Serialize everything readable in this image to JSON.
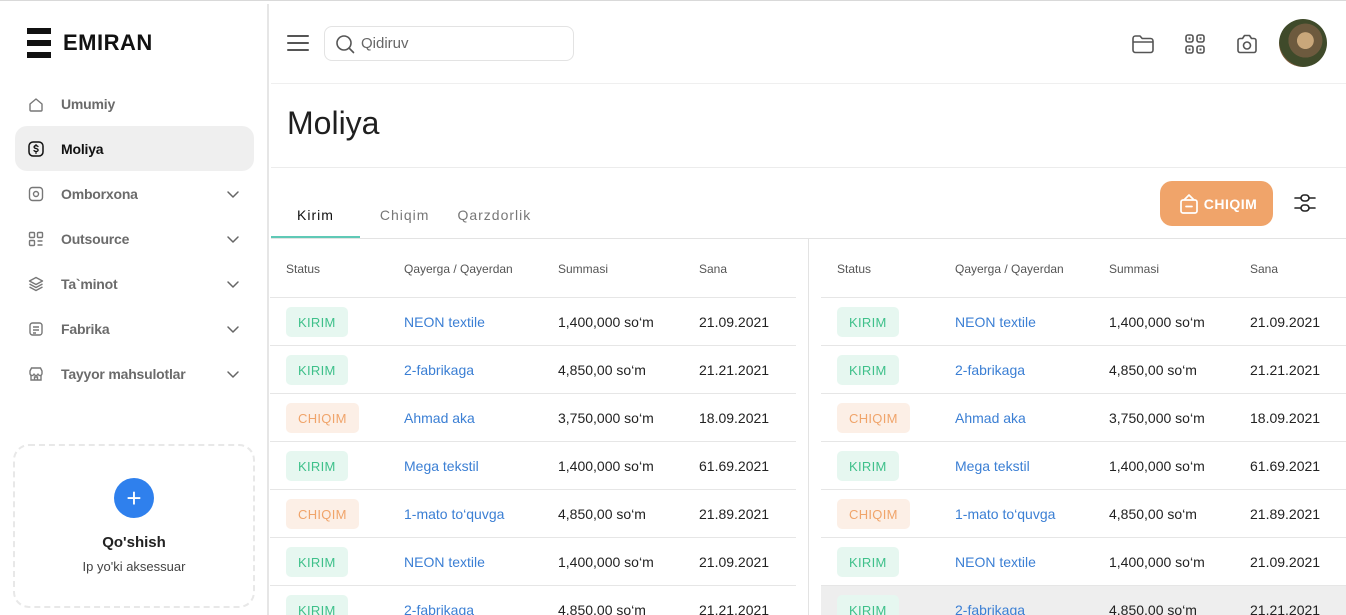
{
  "brand": {
    "name": "EMIRAN"
  },
  "sidebar": {
    "items": [
      {
        "label": "Umumiy",
        "icon": "home-icon",
        "active": false,
        "expandable": false
      },
      {
        "label": "Moliya",
        "icon": "dollar-icon",
        "active": true,
        "expandable": false
      },
      {
        "label": "Omborxona",
        "icon": "box-icon",
        "active": false,
        "expandable": true
      },
      {
        "label": "Outsource",
        "icon": "grid-icon",
        "active": false,
        "expandable": true
      },
      {
        "label": "Ta`minot",
        "icon": "layers-icon",
        "active": false,
        "expandable": true
      },
      {
        "label": "Fabrika",
        "icon": "factory-icon",
        "active": false,
        "expandable": true
      },
      {
        "label": "Tayyor mahsulotlar",
        "icon": "store-icon",
        "active": false,
        "expandable": true
      }
    ],
    "add_card": {
      "title": "Qo'shish",
      "subtitle": "Ip yo'ki aksessuar"
    }
  },
  "header": {
    "search_placeholder": "Qidiruv",
    "icons": [
      "folder-icon",
      "qr-scan-icon",
      "camera-icon"
    ]
  },
  "page": {
    "title": "Moliya"
  },
  "tabs": [
    {
      "label": "Kirim",
      "active": true
    },
    {
      "label": "Chiqim",
      "active": false
    },
    {
      "label": "Qarzdorlik",
      "active": false
    }
  ],
  "action_button": {
    "label": "CHIQIM"
  },
  "colors": {
    "accent_orange": "#f0a46a",
    "accent_teal": "#5fc9b6",
    "link_blue": "#3b7fd4",
    "kirim_green": "#3ec08a",
    "primary_blue": "#2f80ed"
  },
  "table": {
    "columns": [
      "Status",
      "Qayerga / Qayerdan",
      "Summasi",
      "Sana"
    ],
    "rows": [
      {
        "status": "KIRIM",
        "type": "kirim",
        "party": "NEON textile",
        "amount": "1,400,000 so‘m",
        "date": "21.09.2021"
      },
      {
        "status": "KIRIM",
        "type": "kirim",
        "party": "2-fabrikaga",
        "amount": "4,850,00 so‘m",
        "date": "21.21.2021"
      },
      {
        "status": "CHIQIM",
        "type": "chiqim",
        "party": "Ahmad aka",
        "amount": "3,750,000 so‘m",
        "date": "18.09.2021"
      },
      {
        "status": "KIRIM",
        "type": "kirim",
        "party": "Mega tekstil",
        "amount": "1,400,000 so‘m",
        "date": "61.69.2021"
      },
      {
        "status": "CHIQIM",
        "type": "chiqim",
        "party": "1-mato to‘quvga",
        "amount": "4,850,00 so‘m",
        "date": "21.89.2021"
      },
      {
        "status": "KIRIM",
        "type": "kirim",
        "party": "NEON textile",
        "amount": "1,400,000 so‘m",
        "date": "21.09.2021"
      },
      {
        "status": "KIRIM",
        "type": "kirim",
        "party": "2-fabrikaga",
        "amount": "4,850,00 so‘m",
        "date": "21.21.2021"
      }
    ]
  }
}
